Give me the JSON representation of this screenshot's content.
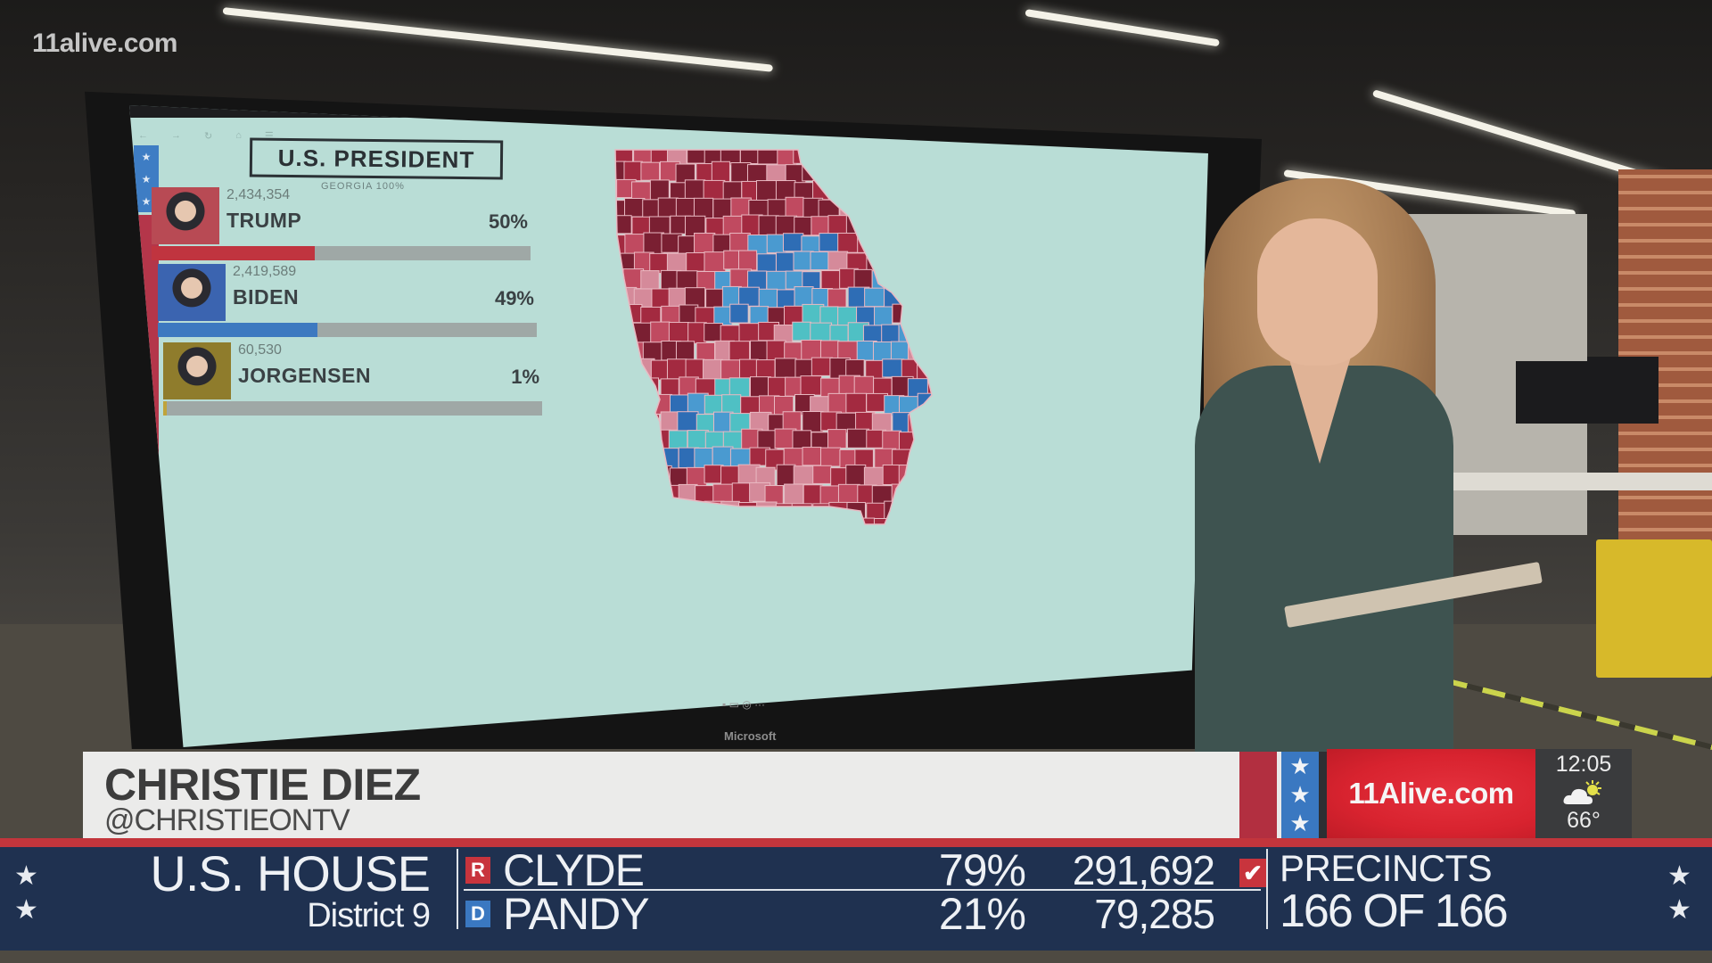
{
  "station_bug": "11alive.com",
  "monitor": {
    "brand": "Microsoft",
    "browser_toolbar": [
      "←",
      "→",
      "↻",
      "⌂",
      "☰"
    ],
    "results_panel": {
      "race_title": "U.S. PRESIDENT",
      "race_subtitle": "GEORGIA 100%",
      "candidates": [
        {
          "name": "TRUMP",
          "votes": "2,434,354",
          "percent": "50%",
          "share": 0.5,
          "color": "#c0343f",
          "photo_bg": "#b84a54"
        },
        {
          "name": "BIDEN",
          "votes": "2,419,589",
          "percent": "49%",
          "share": 0.49,
          "color": "#3d79c0",
          "photo_bg": "#3b64b0"
        },
        {
          "name": "JORGENSEN",
          "votes": "60,530",
          "percent": "1%",
          "share": 0.01,
          "color": "#c0a43a",
          "photo_bg": "#8f7c2c"
        }
      ]
    },
    "map": {
      "label": "Georgia county results",
      "colors": {
        "strong_r": "#7a1f32",
        "r": "#a32a40",
        "lean_r": "#c04a60",
        "tilt_r": "#d58a9a",
        "tilt_d": "#4fc0c4",
        "lean_d": "#4a9ad0",
        "strong_d": "#2e6db5",
        "border": "#e9b9c2"
      }
    }
  },
  "lower_third": {
    "name": "CHRISTIE DIEZ",
    "handle": "@CHRISTIEONTV",
    "logo_text": "11Alive.com",
    "time": "12:05",
    "weather_icon": "partly-cloudy-icon",
    "temperature": "66°"
  },
  "ticker": {
    "office": "U.S. HOUSE",
    "district": "District 9",
    "rows": [
      {
        "party": "R",
        "party_color": "#c8343d",
        "name": "CLYDE",
        "percent": "79%",
        "votes": "291,692",
        "winner": true
      },
      {
        "party": "D",
        "party_color": "#3a78c1",
        "name": "PANDY",
        "percent": "21%",
        "votes": "79,285",
        "winner": false
      }
    ],
    "precincts_label": "PRECINCTS",
    "precincts_value": "166 OF 166",
    "check_glyph": "✔",
    "star_glyph": "★"
  }
}
